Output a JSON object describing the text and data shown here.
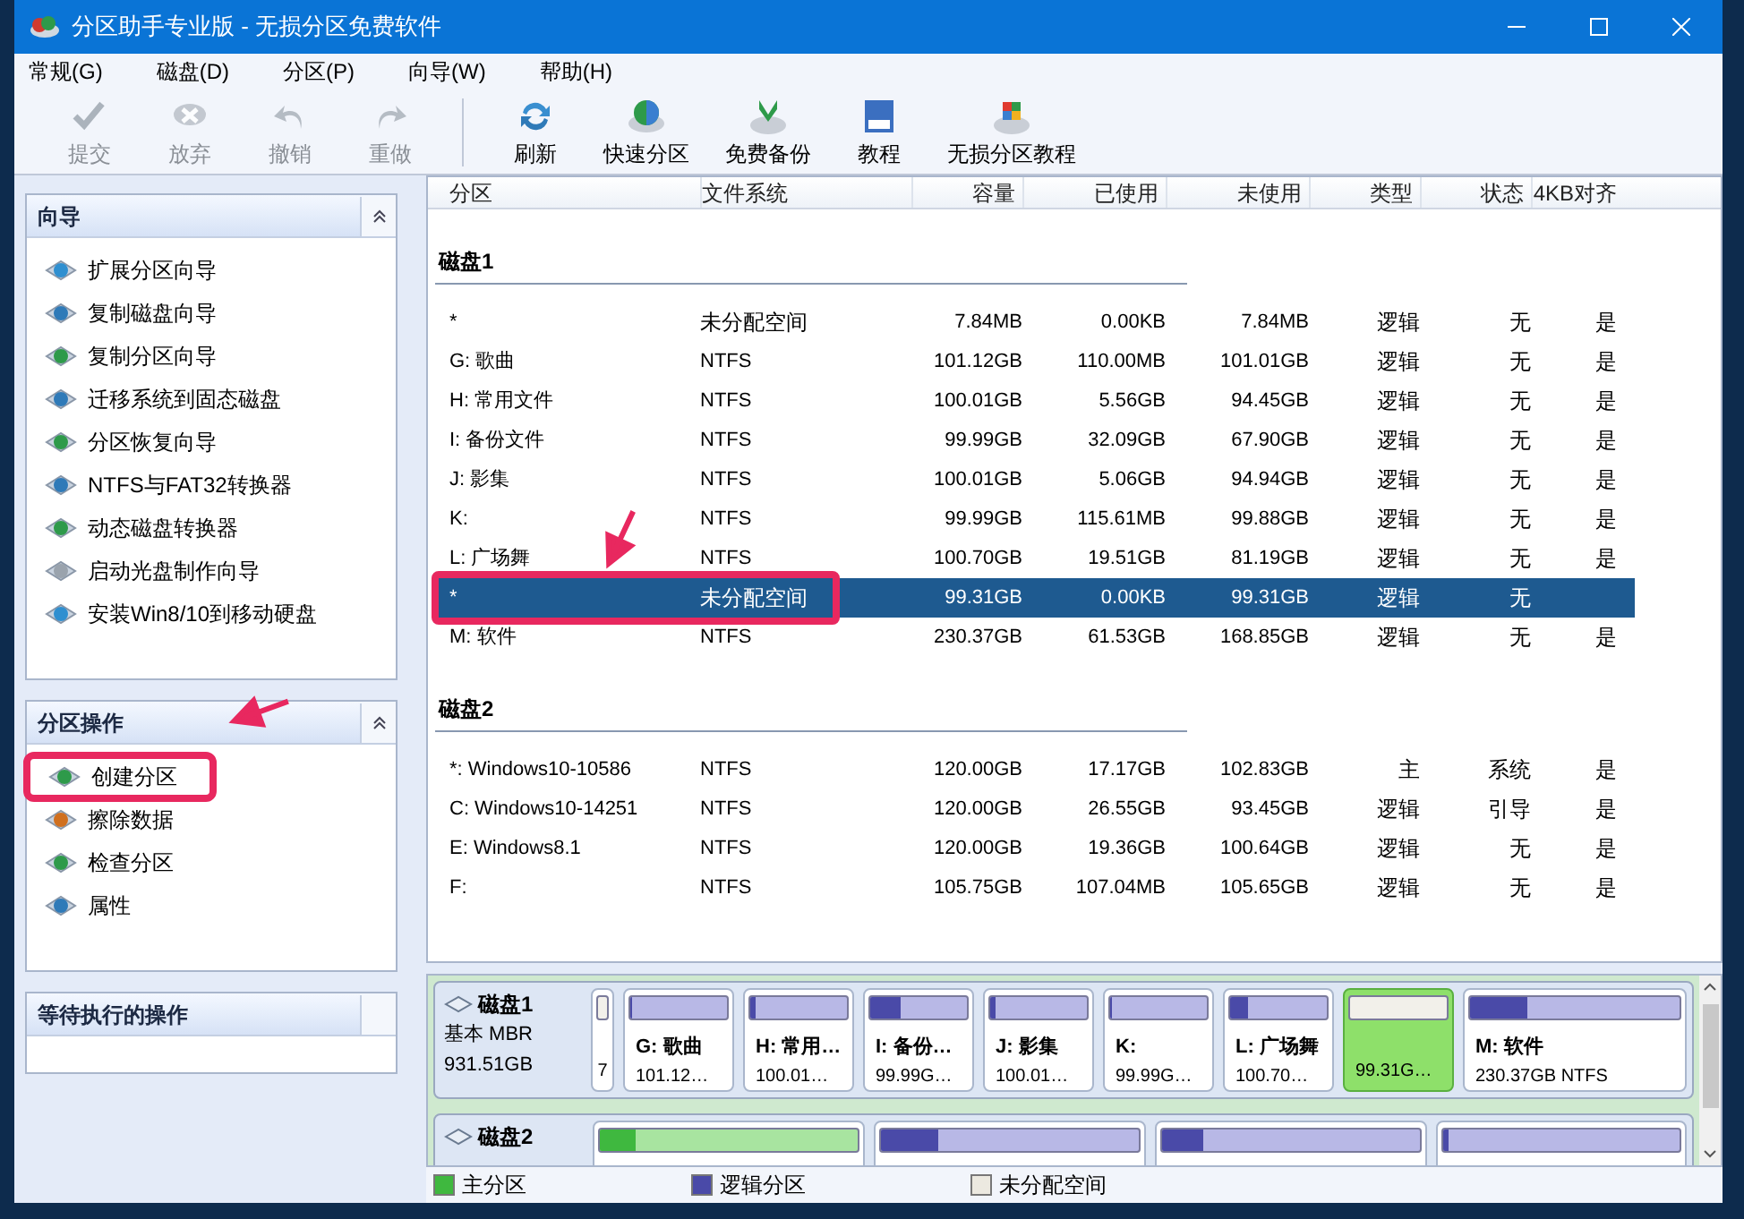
{
  "window": {
    "title": "分区助手专业版 - 无损分区免费软件"
  },
  "menu": [
    "常规(G)",
    "磁盘(D)",
    "分区(P)",
    "向导(W)",
    "帮助(H)"
  ],
  "toolbar": [
    {
      "label": "提交",
      "kind": "check",
      "disabled": true
    },
    {
      "label": "放弃",
      "kind": "discard",
      "disabled": true
    },
    {
      "label": "撤销",
      "kind": "undo",
      "disabled": true
    },
    {
      "label": "重做",
      "kind": "redo",
      "disabled": true
    },
    {
      "label": "刷新",
      "kind": "refresh",
      "disabled": false
    },
    {
      "label": "快速分区",
      "kind": "disk",
      "disabled": false
    },
    {
      "label": "免费备份",
      "kind": "backup",
      "disabled": false
    },
    {
      "label": "教程",
      "kind": "book",
      "disabled": false
    },
    {
      "label": "无损分区教程",
      "kind": "tutorial",
      "disabled": false
    }
  ],
  "sidebar": [
    {
      "title": "向导",
      "expanded": true,
      "items": [
        {
          "label": "扩展分区向导",
          "highlighted": false
        },
        {
          "label": "复制磁盘向导",
          "highlighted": false
        },
        {
          "label": "复制分区向导",
          "highlighted": false
        },
        {
          "label": "迁移系统到固态磁盘",
          "highlighted": false
        },
        {
          "label": "分区恢复向导",
          "highlighted": false
        },
        {
          "label": "NTFS与FAT32转换器",
          "highlighted": false
        },
        {
          "label": "动态磁盘转换器",
          "highlighted": false
        },
        {
          "label": "启动光盘制作向导",
          "highlighted": false
        },
        {
          "label": "安装Win8/10到移动硬盘",
          "highlighted": false
        }
      ]
    },
    {
      "title": "分区操作",
      "expanded": true,
      "items": [
        {
          "label": "创建分区",
          "highlighted": true
        },
        {
          "label": "擦除数据",
          "highlighted": false
        },
        {
          "label": "检查分区",
          "highlighted": false
        },
        {
          "label": "属性",
          "highlighted": false
        }
      ]
    },
    {
      "title": "等待执行的操作",
      "expanded": false
    }
  ],
  "table": {
    "columns": [
      "分区",
      "文件系统",
      "容量",
      "已使用",
      "未使用",
      "类型",
      "状态",
      "4KB对齐"
    ],
    "disks": [
      {
        "name": "磁盘1",
        "rows": [
          {
            "cells": [
              "*",
              "未分配空间",
              "7.84MB",
              "0.00KB",
              "7.84MB",
              "逻辑",
              "无",
              "是"
            ],
            "selected": false,
            "highlighted": false
          },
          {
            "cells": [
              "G: 歌曲",
              "NTFS",
              "101.12GB",
              "110.00MB",
              "101.01GB",
              "逻辑",
              "无",
              "是"
            ],
            "selected": false,
            "highlighted": false
          },
          {
            "cells": [
              "H: 常用文件",
              "NTFS",
              "100.01GB",
              "5.56GB",
              "94.45GB",
              "逻辑",
              "无",
              "是"
            ],
            "selected": false,
            "highlighted": false
          },
          {
            "cells": [
              "I: 备份文件",
              "NTFS",
              "99.99GB",
              "32.09GB",
              "67.90GB",
              "逻辑",
              "无",
              "是"
            ],
            "selected": false,
            "highlighted": false
          },
          {
            "cells": [
              "J: 影集",
              "NTFS",
              "100.01GB",
              "5.06GB",
              "94.94GB",
              "逻辑",
              "无",
              "是"
            ],
            "selected": false,
            "highlighted": false
          },
          {
            "cells": [
              "K:",
              "NTFS",
              "99.99GB",
              "115.61MB",
              "99.88GB",
              "逻辑",
              "无",
              "是"
            ],
            "selected": false,
            "highlighted": false
          },
          {
            "cells": [
              "L: 广场舞",
              "NTFS",
              "100.70GB",
              "19.51GB",
              "81.19GB",
              "逻辑",
              "无",
              "是"
            ],
            "selected": false,
            "highlighted": false
          },
          {
            "cells": [
              "*",
              "未分配空间",
              "99.31GB",
              "0.00KB",
              "99.31GB",
              "逻辑",
              "无",
              ""
            ],
            "selected": true,
            "highlighted": true
          },
          {
            "cells": [
              "M: 软件",
              "NTFS",
              "230.37GB",
              "61.53GB",
              "168.85GB",
              "逻辑",
              "无",
              "是"
            ],
            "selected": false,
            "highlighted": false
          }
        ]
      },
      {
        "name": "磁盘2",
        "rows": [
          {
            "cells": [
              "*: Windows10-10586",
              "NTFS",
              "120.00GB",
              "17.17GB",
              "102.83GB",
              "主",
              "系统",
              "是"
            ],
            "selected": false,
            "highlighted": false
          },
          {
            "cells": [
              "C: Windows10-14251",
              "NTFS",
              "120.00GB",
              "26.55GB",
              "93.45GB",
              "逻辑",
              "引导",
              "是"
            ],
            "selected": false,
            "highlighted": false
          },
          {
            "cells": [
              "E: Windows8.1",
              "NTFS",
              "120.00GB",
              "19.36GB",
              "100.64GB",
              "逻辑",
              "无",
              "是"
            ],
            "selected": false,
            "highlighted": false
          },
          {
            "cells": [
              "F:",
              "NTFS",
              "105.75GB",
              "107.04MB",
              "105.65GB",
              "逻辑",
              "无",
              "是"
            ],
            "selected": false,
            "highlighted": false
          }
        ]
      }
    ]
  },
  "disk_map": [
    {
      "name": "磁盘1",
      "type": "基本 MBR",
      "size": "931.51GB",
      "partitions": [
        {
          "size": "7",
          "kind": "unallocated",
          "selected": false
        },
        {
          "name": "G: 歌曲",
          "size": "101.12…",
          "kind": "logical",
          "level": 0.02,
          "selected": false
        },
        {
          "name": "H: 常用…",
          "size": "100.01…",
          "kind": "logical",
          "level": 0.06,
          "selected": false
        },
        {
          "name": "I: 备份…",
          "size": "99.99G…",
          "kind": "logical",
          "level": 0.32,
          "selected": false
        },
        {
          "name": "J: 影集",
          "size": "100.01…",
          "kind": "logical",
          "level": 0.05,
          "selected": false
        },
        {
          "name": "K:",
          "size": "99.99G…",
          "kind": "logical",
          "level": 0.01,
          "selected": false
        },
        {
          "name": "L: 广场舞",
          "size": "100.70…",
          "kind": "logical",
          "level": 0.19,
          "selected": false
        },
        {
          "size": "99.31G…",
          "kind": "unallocated",
          "selected": true
        },
        {
          "name": "M: 软件",
          "size": "230.37GB NTFS",
          "kind": "logical",
          "level": 0.27,
          "selected": false
        }
      ]
    },
    {
      "name": "磁盘2",
      "partitions": [
        {
          "kind": "primary",
          "level": 0.14,
          "selected": false
        },
        {
          "kind": "logical",
          "level": 0.22,
          "selected": false
        },
        {
          "kind": "logical",
          "level": 0.16,
          "selected": false
        },
        {
          "kind": "logical",
          "level": 0.02,
          "selected": false
        }
      ]
    }
  ],
  "legend": [
    {
      "label": "主分区",
      "color": "#3fb83f"
    },
    {
      "label": "逻辑分区",
      "color": "#4a4aa8"
    },
    {
      "label": "未分配空间",
      "color": "#ece9e0"
    }
  ],
  "annotations": [
    {
      "kind": "arrow"
    },
    {
      "kind": "arrow"
    }
  ]
}
